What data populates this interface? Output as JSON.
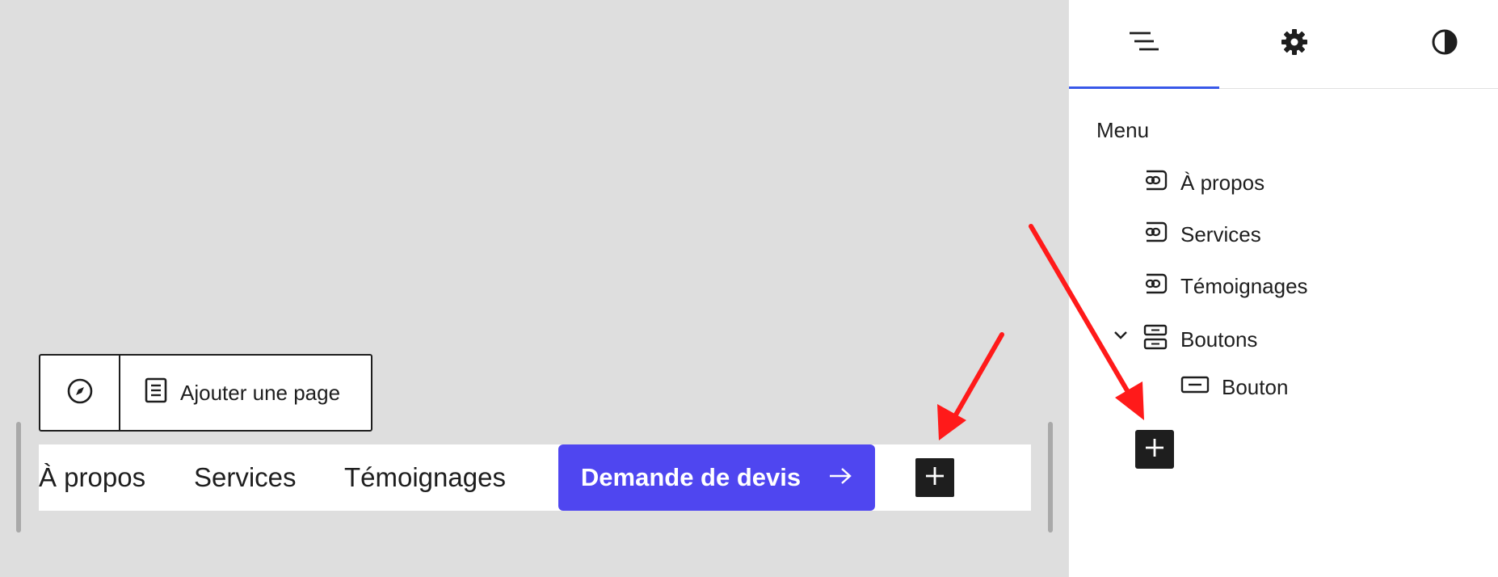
{
  "canvas": {
    "toolbar": {
      "compass_icon": "compass-icon",
      "add_page_icon": "page-icon",
      "add_page_label": "Ajouter une page"
    },
    "nav": {
      "links": [
        "À propos",
        "Services",
        "Témoignages"
      ],
      "cta_label": "Demande de devis",
      "cta_icon": "arrow-right-icon",
      "cta_color": "#4f46f0",
      "add_icon": "plus-icon"
    }
  },
  "sidebar": {
    "tabs": [
      {
        "icon": "list-view-icon",
        "active": true
      },
      {
        "icon": "gear-icon",
        "active": false
      },
      {
        "icon": "half-circle-icon",
        "active": false
      }
    ],
    "active_tab_color": "#3858e9",
    "title": "Menu",
    "tree": [
      {
        "label": "À propos",
        "icon": "link-icon"
      },
      {
        "label": "Services",
        "icon": "link-icon"
      },
      {
        "label": "Témoignages",
        "icon": "link-icon"
      },
      {
        "label": "Boutons",
        "icon": "buttons-icon",
        "expanded": true
      },
      {
        "label": "Bouton",
        "icon": "button-icon"
      }
    ],
    "add_icon": "plus-icon"
  },
  "annotations": {
    "arrow_color": "#ff1a1a"
  }
}
